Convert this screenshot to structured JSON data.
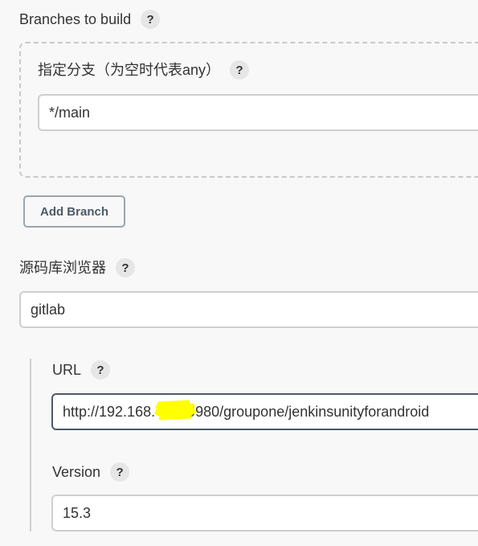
{
  "branches": {
    "label": "Branches to build",
    "help_icon": "?",
    "specifier": {
      "label": "指定分支（为空时代表any）",
      "help_icon": "?",
      "value": "*/main"
    },
    "add_branch_label": "Add Branch"
  },
  "repo_browser": {
    "label": "源码库浏览器",
    "help_icon": "?",
    "value": "gitlab"
  },
  "url": {
    "label": "URL",
    "help_icon": "?",
    "value": "http://192.168.        9980/groupone/jenkinsunityforandroid"
  },
  "version": {
    "label": "Version",
    "help_icon": "?",
    "value": "15.3"
  },
  "colors": {
    "background": "#f8f8f8",
    "focus_border": "#4d5a66",
    "redaction": "#ffff00"
  }
}
